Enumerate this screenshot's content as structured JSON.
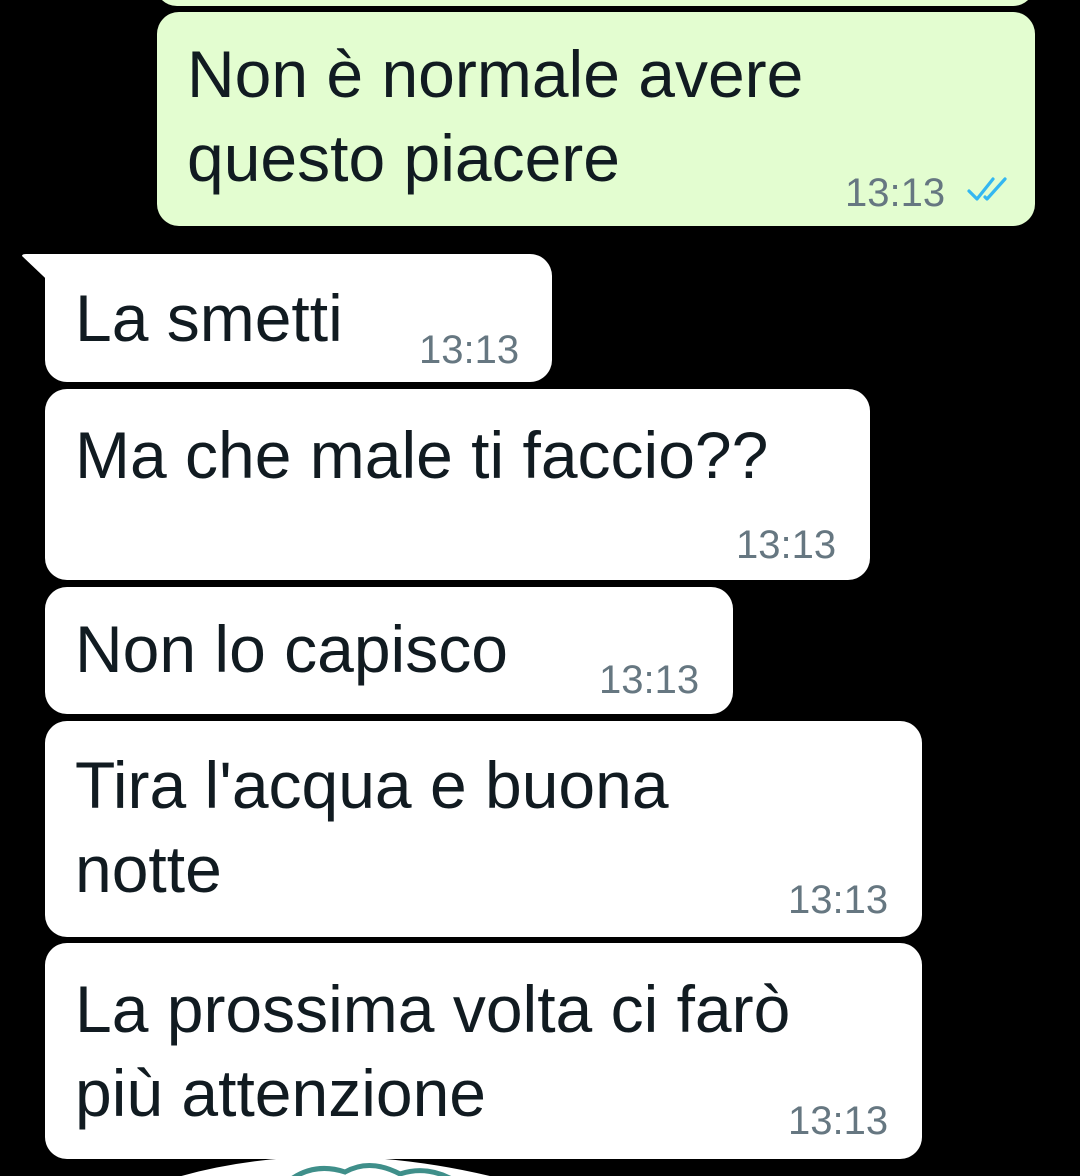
{
  "chat": {
    "messages": [
      {
        "direction": "outgoing",
        "text": "Non è normale avere\nquesto piacere",
        "time": "13:13",
        "status": "read-double-check-icon"
      },
      {
        "direction": "incoming",
        "text": "La smetti",
        "time": "13:13"
      },
      {
        "direction": "incoming",
        "text": "Ma che male ti faccio??",
        "time": "13:13"
      },
      {
        "direction": "incoming",
        "text": "Non lo capisco",
        "time": "13:13"
      },
      {
        "direction": "incoming",
        "text": "Tira l'acqua e buona\nnotte",
        "time": "13:13"
      },
      {
        "direction": "incoming",
        "text": "La prossima volta ci farò\npiù attenzione",
        "time": "13:13"
      }
    ]
  },
  "colors": {
    "background": "#000000",
    "outgoing_bubble": "#e3fdd0",
    "incoming_bubble": "#ffffff",
    "message_text": "#111b21",
    "timestamp": "#667781",
    "read_ticks": "#34b7f1"
  }
}
